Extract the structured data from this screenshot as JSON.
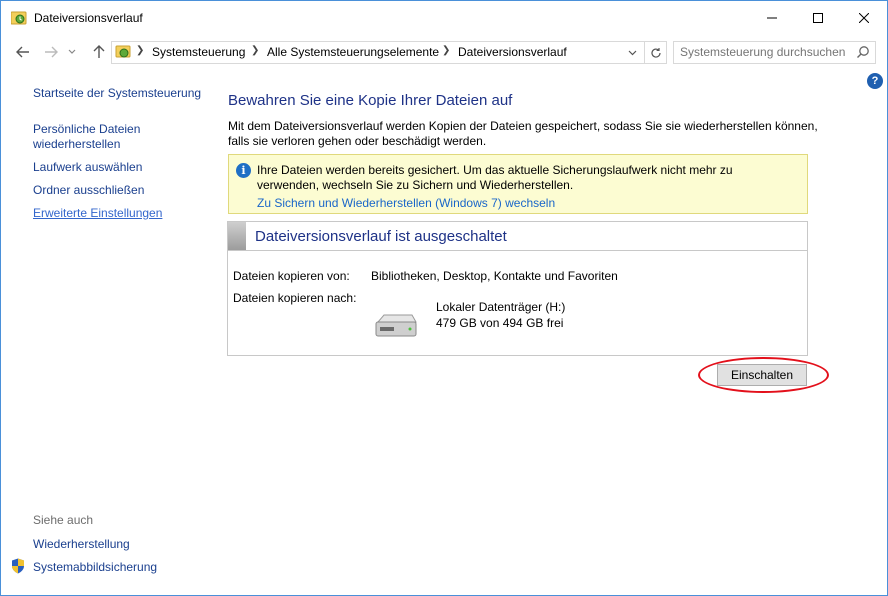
{
  "window": {
    "title": "Dateiversionsverlauf",
    "minimize_icon": "minimize-icon",
    "maximize_icon": "maximize-icon",
    "close_icon": "close-icon"
  },
  "nav": {
    "breadcrumbs": [
      "Systemsteuerung",
      "Alle Systemsteuerungselemente",
      "Dateiversionsverlauf"
    ],
    "search_placeholder": "Systemsteuerung durchsuchen",
    "help_label": "?"
  },
  "sidebar": {
    "items": [
      {
        "label": "Startseite der Systemsteuerung"
      },
      {
        "label": "Persönliche Dateien wiederherstellen"
      },
      {
        "label": "Laufwerk auswählen"
      },
      {
        "label": "Ordner ausschließen"
      },
      {
        "label": "Erweiterte Einstellungen"
      }
    ],
    "see_also_title": "Siehe auch",
    "see_also": [
      {
        "label": "Wiederherstellung"
      },
      {
        "label": "Systemabbildsicherung"
      }
    ]
  },
  "main": {
    "heading": "Bewahren Sie eine Kopie Ihrer Dateien auf",
    "intro": "Mit dem Dateiversionsverlauf werden Kopien der Dateien gespeichert, sodass Sie sie wiederherstellen können, falls sie verloren gehen oder beschädigt werden.",
    "notice": {
      "text": "Ihre Dateien werden bereits gesichert. Um das aktuelle Sicherungslaufwerk nicht mehr zu verwenden, wechseln Sie zu Sichern und Wiederherstellen.",
      "link": "Zu Sichern und Wiederherstellen (Windows 7) wechseln"
    },
    "status_title": "Dateiversionsverlauf ist ausgeschaltet",
    "copy_from_label": "Dateien kopieren von:",
    "copy_from_value": "Bibliotheken, Desktop, Kontakte und Favoriten",
    "copy_to_label": "Dateien kopieren nach:",
    "drive_name": "Lokaler Datenträger (H:)",
    "drive_space": "479 GB von 494 GB frei",
    "turn_on_button": "Einschalten"
  },
  "colors": {
    "accent_link": "#1a66c9",
    "heading": "#1e3287",
    "notice_bg": "#fcfcd2",
    "highlight_ring": "#e3101b"
  }
}
